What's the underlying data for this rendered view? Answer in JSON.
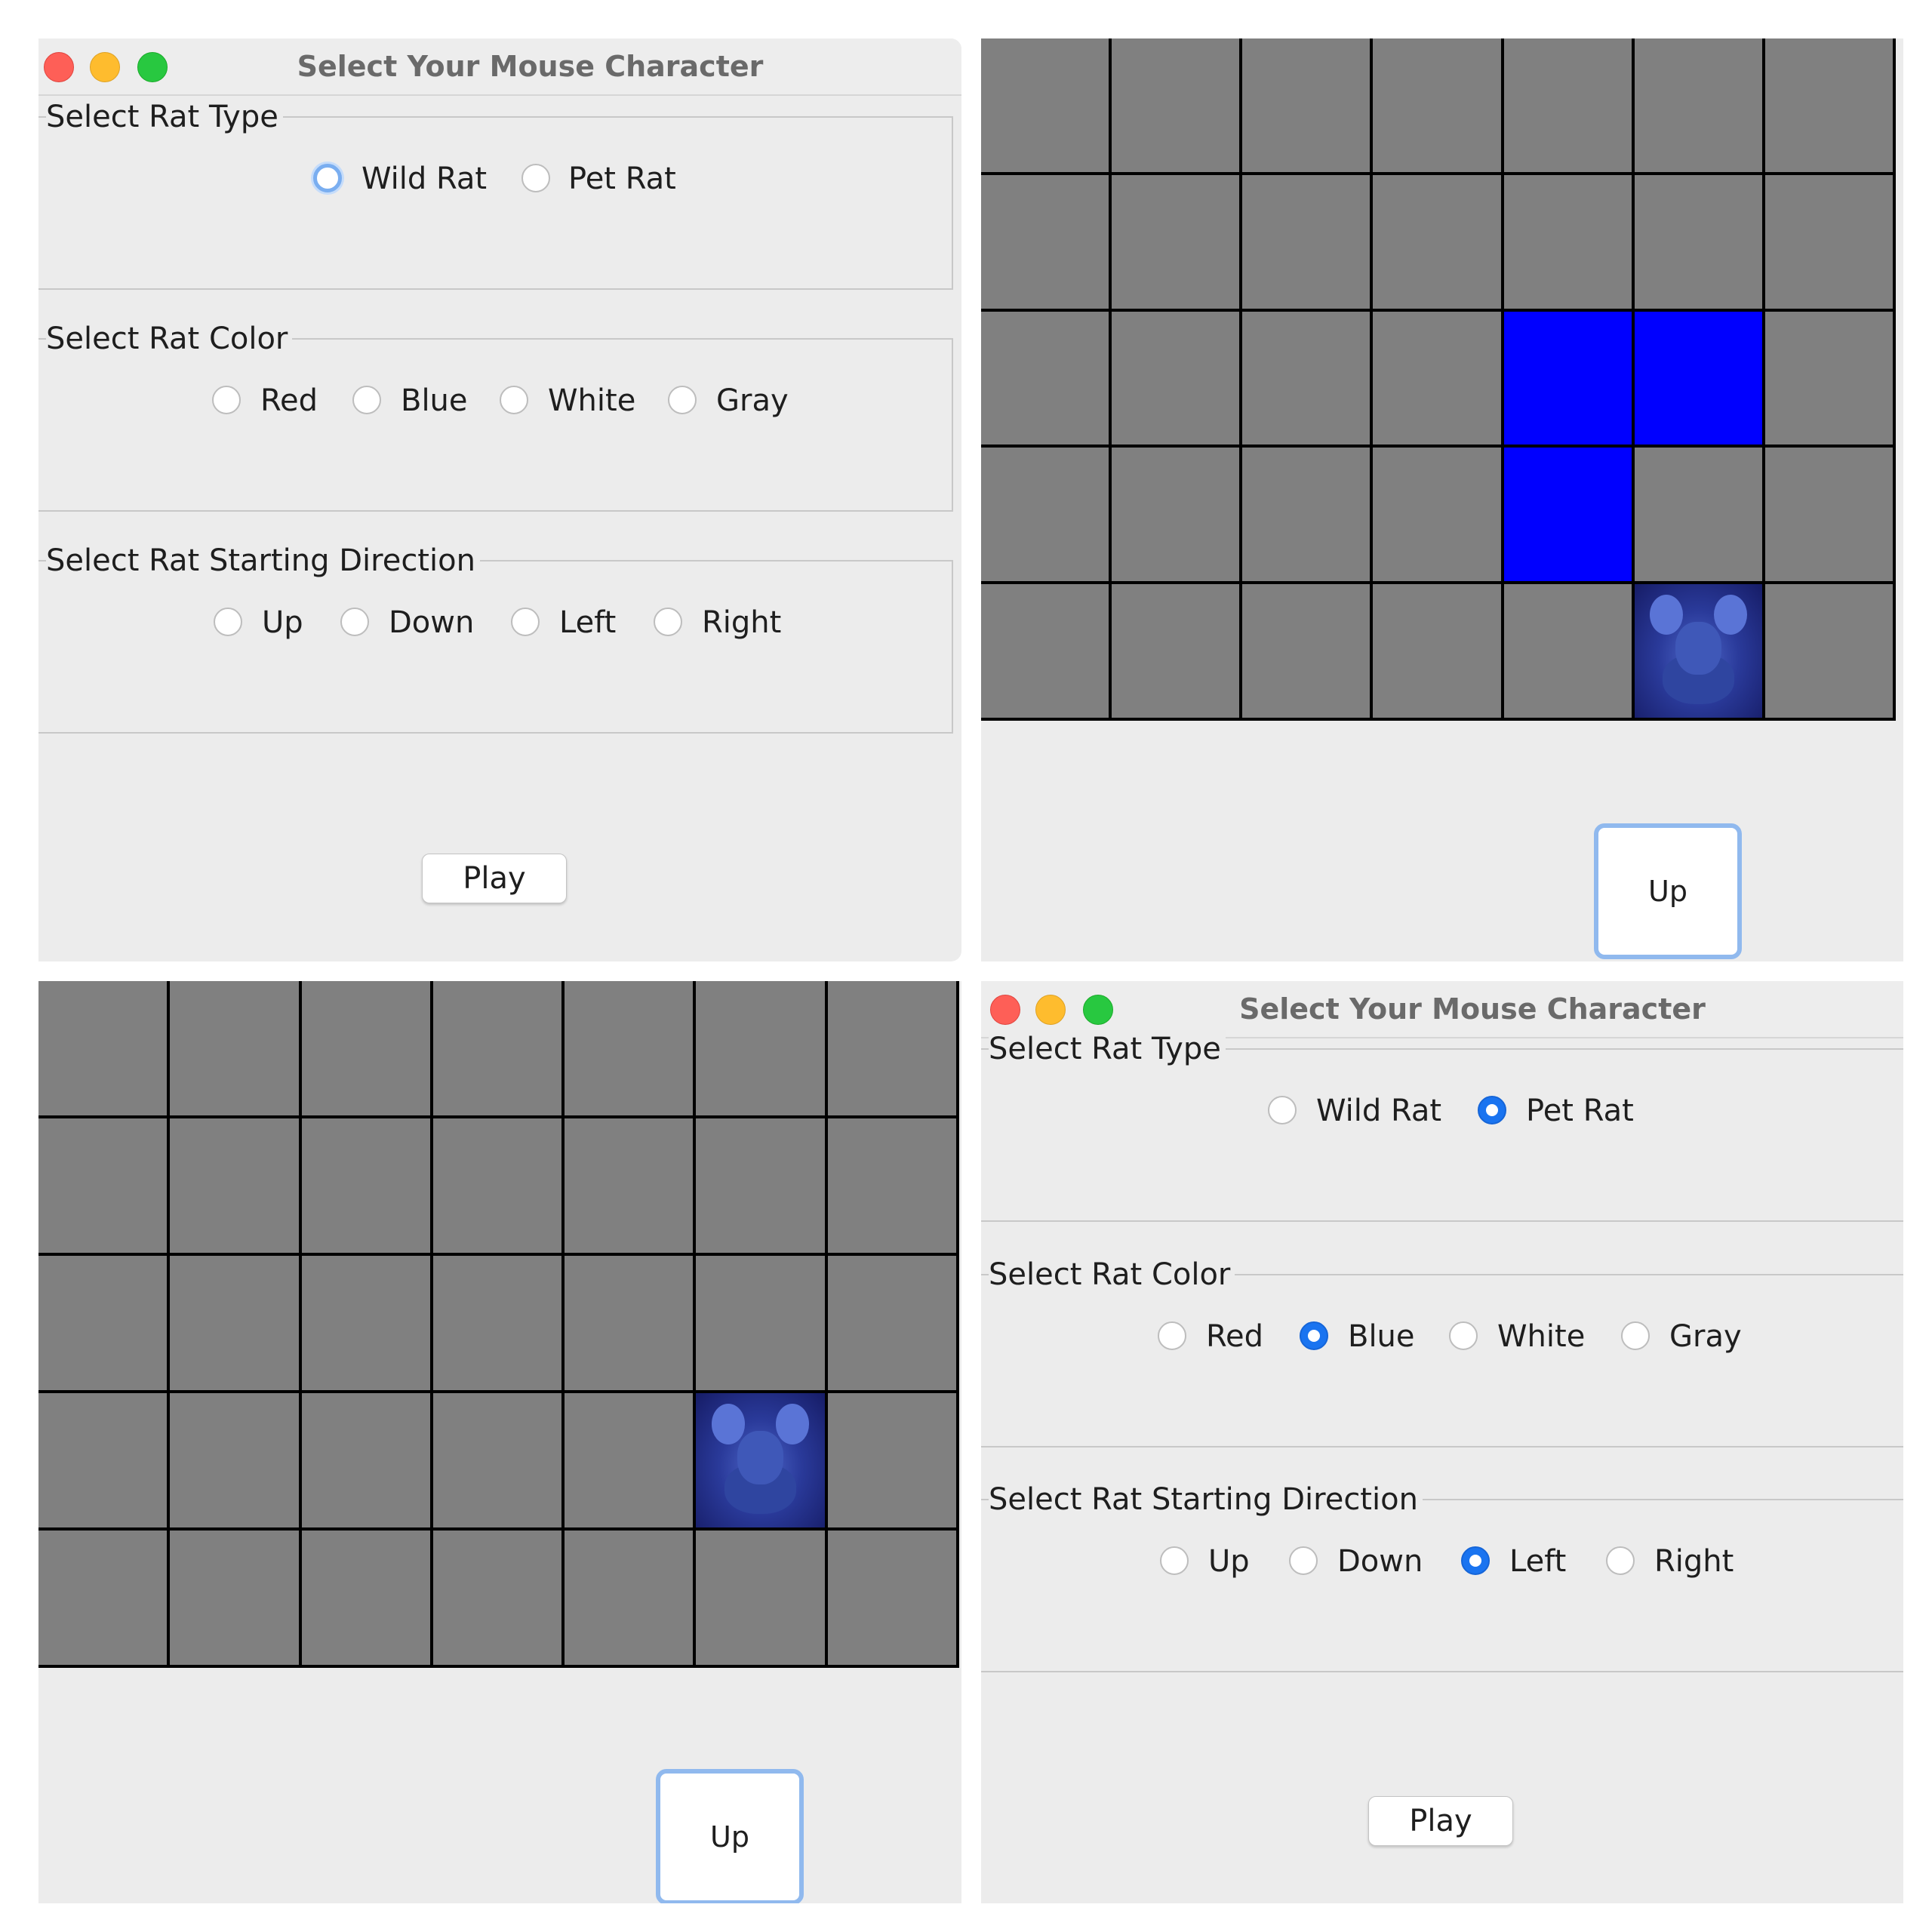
{
  "window": {
    "title": "Select Your Mouse Character"
  },
  "groups": {
    "type": {
      "label": "Select Rat Type",
      "options": [
        "Wild Rat",
        "Pet Rat"
      ]
    },
    "color": {
      "label": "Select Rat Color",
      "options": [
        "Red",
        "Blue",
        "White",
        "Gray"
      ]
    },
    "direction": {
      "label": "Select Rat Starting Direction",
      "options": [
        "Up",
        "Down",
        "Left",
        "Right"
      ]
    }
  },
  "play_label": "Play",
  "up_label": "Up",
  "panel1_state": {
    "type": "none (Wild Rat focused)",
    "color": "none",
    "direction": "none"
  },
  "panel4_state": {
    "type": "Pet Rat",
    "color": "Blue",
    "direction": "Left"
  },
  "colors": {
    "cell": "#808080",
    "path": "#0000ff",
    "grid_line": "#000000",
    "radio_selected": "#1a74f0"
  },
  "board_topright": {
    "rows": 5,
    "cols": 7,
    "path_cells": [
      [
        2,
        4
      ],
      [
        2,
        5
      ],
      [
        3,
        4
      ]
    ],
    "rat_cell": [
      4,
      5
    ]
  },
  "board_bottomleft": {
    "rows": 5,
    "cols": 7,
    "path_cells": [],
    "rat_cell": [
      3,
      5
    ]
  }
}
